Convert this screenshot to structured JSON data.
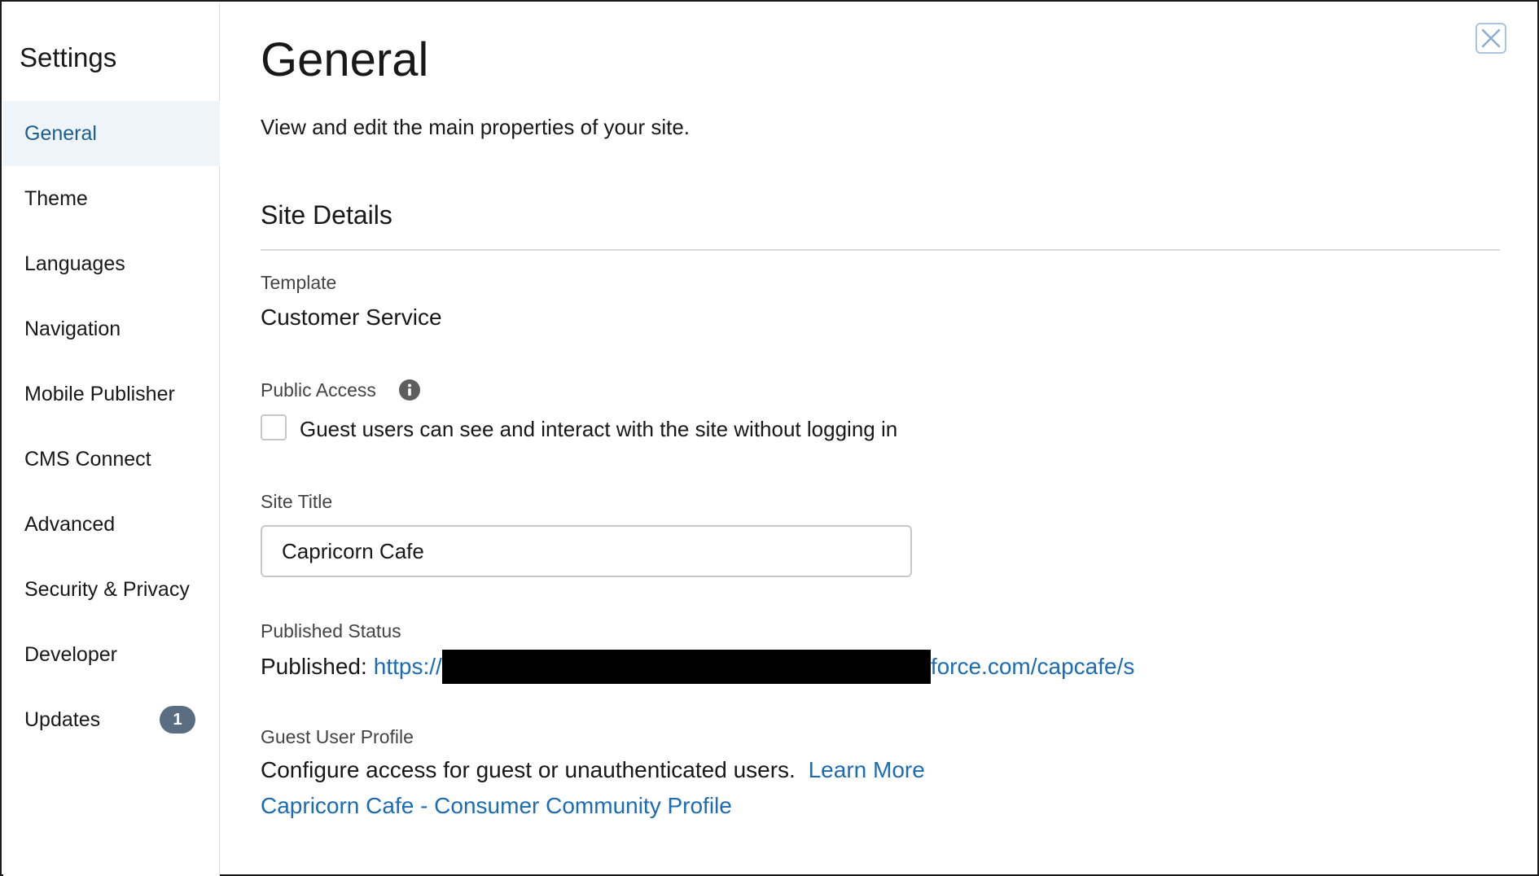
{
  "sidebar": {
    "title": "Settings",
    "items": [
      {
        "label": "General"
      },
      {
        "label": "Theme"
      },
      {
        "label": "Languages"
      },
      {
        "label": "Navigation"
      },
      {
        "label": "Mobile Publisher"
      },
      {
        "label": "CMS Connect"
      },
      {
        "label": "Advanced"
      },
      {
        "label": "Security & Privacy"
      },
      {
        "label": "Developer"
      },
      {
        "label": "Updates",
        "badge": "1"
      }
    ],
    "active_item": "General"
  },
  "close_icon": "close-icon",
  "main": {
    "title": "General",
    "description": "View and edit the main properties of your site.",
    "section_title": "Site Details",
    "template": {
      "label": "Template",
      "value": "Customer Service"
    },
    "public_access": {
      "label": "Public Access",
      "info_icon": "info-icon",
      "checkbox_label": "Guest users can see and interact with the site without logging in",
      "checked": false
    },
    "site_title": {
      "label": "Site Title",
      "value": "Capricorn Cafe"
    },
    "published_status": {
      "label": "Published Status",
      "prefix": "Published:",
      "url_start": "https://",
      "url_end": "force.com/capcafe/s"
    },
    "guest_user_profile": {
      "label": "Guest User Profile",
      "description": "Configure access for guest or unauthenticated users.",
      "learn_more": "Learn More",
      "profile_link": "Capricorn Cafe - Consumer Community Profile"
    }
  },
  "colors": {
    "accent_link": "#1b6cb5",
    "active_nav_bg": "#eef4f8",
    "active_nav_text": "#1b5f8f",
    "badge_bg": "#5b6d80"
  }
}
